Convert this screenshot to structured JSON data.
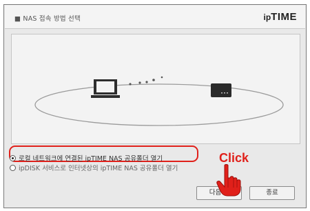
{
  "window": {
    "title": "■ NAS 접속 방법 선택",
    "brand_prefix": "ip",
    "brand_name": "TIME"
  },
  "options": [
    {
      "label": "로컬 네트워크에 연결된 ipTIME NAS 공유폴더 열기",
      "selected": true
    },
    {
      "label": "ipDISK 서비스로 인터넷상의 ipTIME NAS 공유폴더 열기",
      "selected": false
    }
  ],
  "buttons": {
    "next": "다음 >",
    "exit": "종료"
  },
  "annotation": {
    "click_text": "Click",
    "color": "#e0201a"
  }
}
